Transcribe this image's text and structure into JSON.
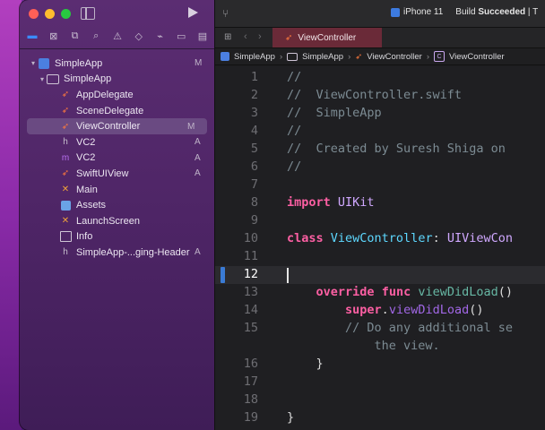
{
  "window": {
    "traffic_lights": [
      "close",
      "minimize",
      "zoom"
    ]
  },
  "toolbar": {
    "scheme_device": "iPhone 11",
    "build_status_prefix": "Build ",
    "build_status": "Succeeded",
    "build_status_suffix": " | T"
  },
  "navigator": {
    "tabs": [
      "folder-icon",
      "xmark-box-icon",
      "hierarchy-icon",
      "search-icon",
      "warning-icon",
      "diamond-icon",
      "spray-icon",
      "tag-icon",
      "doc-icon"
    ],
    "tree": [
      {
        "label": "SimpleApp",
        "status": "M",
        "icon": "project-icon",
        "indent": 0,
        "disclosure": "▾"
      },
      {
        "label": "SimpleApp",
        "status": "",
        "icon": "folder-icon",
        "indent": 1,
        "disclosure": "▾"
      },
      {
        "label": "AppDelegate",
        "status": "",
        "icon": "swift-icon",
        "indent": 2,
        "disclosure": ""
      },
      {
        "label": "SceneDelegate",
        "status": "",
        "icon": "swift-icon",
        "indent": 2,
        "disclosure": ""
      },
      {
        "label": "ViewController",
        "status": "M",
        "icon": "swift-icon",
        "indent": 2,
        "disclosure": "",
        "selected": true
      },
      {
        "label": "VC2",
        "status": "A",
        "icon": "header-icon",
        "indent": 2,
        "disclosure": ""
      },
      {
        "label": "VC2",
        "status": "A",
        "icon": "objc-m-icon",
        "indent": 2,
        "disclosure": ""
      },
      {
        "label": "SwiftUIView",
        "status": "A",
        "icon": "swift-icon",
        "indent": 2,
        "disclosure": ""
      },
      {
        "label": "Main",
        "status": "",
        "icon": "xib-icon",
        "indent": 2,
        "disclosure": ""
      },
      {
        "label": "Assets",
        "status": "",
        "icon": "assets-icon",
        "indent": 2,
        "disclosure": ""
      },
      {
        "label": "LaunchScreen",
        "status": "",
        "icon": "xib-icon",
        "indent": 2,
        "disclosure": ""
      },
      {
        "label": "Info",
        "status": "",
        "icon": "plist-icon",
        "indent": 2,
        "disclosure": ""
      },
      {
        "label": "SimpleApp-...ging-Header",
        "status": "A",
        "icon": "header-icon",
        "indent": 2,
        "disclosure": ""
      }
    ]
  },
  "tab": {
    "label": "ViewController"
  },
  "jumpbar": {
    "items": [
      "SimpleApp",
      "SimpleApp",
      "ViewController",
      "ViewController"
    ]
  },
  "editor": {
    "current_line": 12,
    "lines": [
      {
        "n": "1",
        "t": "//"
      },
      {
        "n": "2",
        "t": "//  ViewController.swift"
      },
      {
        "n": "3",
        "t": "//  SimpleApp"
      },
      {
        "n": "4",
        "t": "//"
      },
      {
        "n": "5",
        "t": "//  Created by Suresh Shiga on"
      },
      {
        "n": "6",
        "t": "//"
      },
      {
        "n": "7",
        "t": ""
      },
      {
        "n": "8",
        "t": "import UIKit"
      },
      {
        "n": "9",
        "t": ""
      },
      {
        "n": "10",
        "t": "class ViewController: UIViewCon"
      },
      {
        "n": "11",
        "t": ""
      },
      {
        "n": "12",
        "t": ""
      },
      {
        "n": "13",
        "t": "    override func viewDidLoad()"
      },
      {
        "n": "14",
        "t": "        super.viewDidLoad()"
      },
      {
        "n": "15",
        "t": "        // Do any additional se"
      },
      {
        "n": "",
        "t": "            the view."
      },
      {
        "n": "16",
        "t": "    }"
      },
      {
        "n": "17",
        "t": ""
      },
      {
        "n": "18",
        "t": ""
      },
      {
        "n": "19",
        "t": "}"
      }
    ]
  },
  "colors": {
    "keyword": "#fc5fa3",
    "comment": "#7c8b93",
    "type": "#d0a8ff",
    "method": "#67b7a4",
    "accent": "#3a7bd5"
  }
}
